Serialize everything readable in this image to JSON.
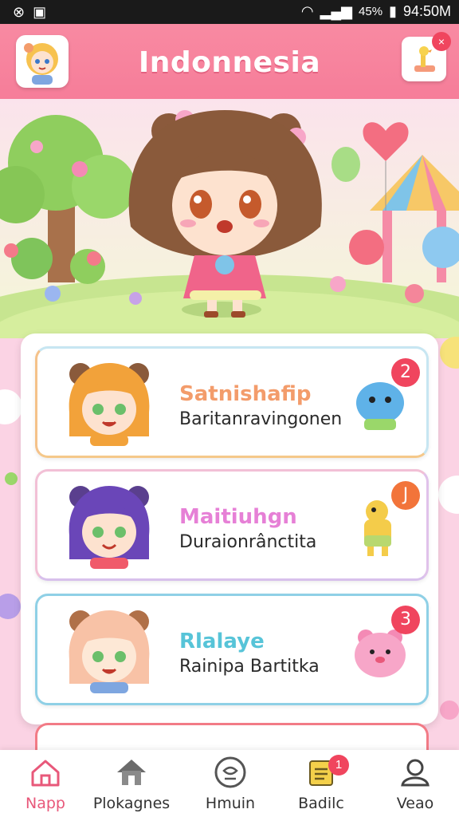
{
  "status_bar": {
    "time": "94:50M",
    "battery": "45%"
  },
  "header": {
    "title": "Indonnesia",
    "close_badge": "×"
  },
  "list": [
    {
      "title": "Satnishafip",
      "subtitle": "Baritanravingonen",
      "badge": "2",
      "title_color": "#f39c6b",
      "badge_color": "#f0455e"
    },
    {
      "title": "Maitiuhgn",
      "subtitle": "Duraionrânctita",
      "badge": "J",
      "title_color": "#e680d6",
      "badge_color": "#f2743a"
    },
    {
      "title": "Rlalaye",
      "subtitle": "Rainipa Bartitka",
      "badge": "3",
      "title_color": "#57c4d8",
      "badge_color": "#f0455e"
    }
  ],
  "nav": [
    {
      "label": "Napp",
      "icon": "home-icon",
      "active": true
    },
    {
      "label": "Plokagnes",
      "icon": "house-icon",
      "active": false
    },
    {
      "label": "Hmuin",
      "icon": "chat-icon",
      "active": false
    },
    {
      "label": "Badilc",
      "icon": "notes-icon",
      "active": false,
      "badge": "1"
    },
    {
      "label": "Veao",
      "icon": "profile-icon",
      "active": false
    }
  ]
}
